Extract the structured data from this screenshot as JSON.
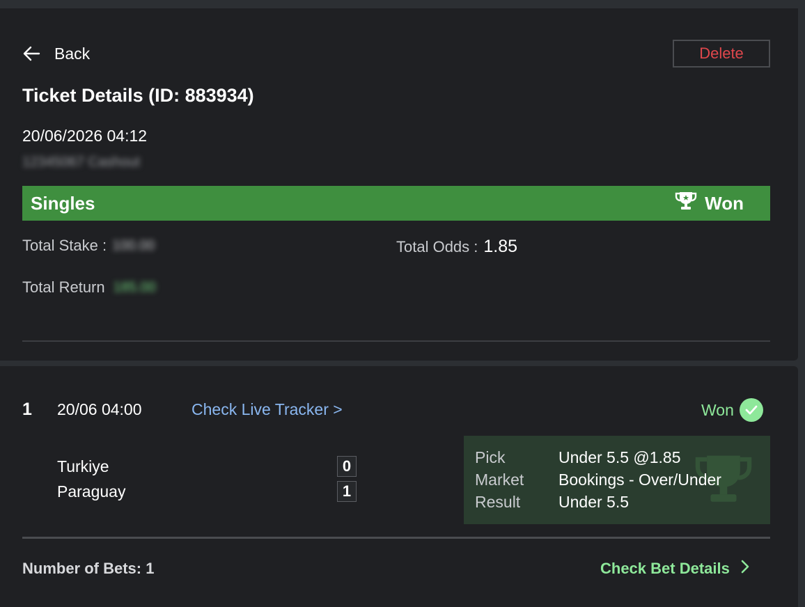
{
  "header": {
    "back_label": "Back",
    "delete_label": "Delete"
  },
  "ticket": {
    "title": "Ticket Details (ID: 883934)",
    "datetime": "20/06/2026 04:12",
    "sub_text_blurred": "12345067 Cashout",
    "bet_type": "Singles",
    "status": "Won",
    "total_stake_label": "Total Stake :",
    "total_stake_value_blurred": "100.00",
    "total_odds_label": "Total Odds :",
    "total_odds_value": "1.85",
    "total_return_label": "Total Return",
    "total_return_value_blurred": "185.00"
  },
  "bet": {
    "index": "1",
    "time": "20/06 04:00",
    "live_tracker_label": "Check Live Tracker >",
    "status": "Won",
    "home_team": "Turkiye",
    "away_team": "Paraguay",
    "home_score": "0",
    "away_score": "1",
    "pick_label": "Pick",
    "pick_value": "Under 5.5 @1.85",
    "market_label": "Market",
    "market_value": "Bookings - Over/Under",
    "result_label": "Result",
    "result_value": "Under 5.5"
  },
  "footer": {
    "number_of_bets": "Number of Bets: 1",
    "check_details_label": "Check Bet Details"
  },
  "colors": {
    "status_bar": "#3f8f3f",
    "won_text": "#8ee89a",
    "delete_text": "#e0474c",
    "link_blue": "#8ab7f0",
    "card_bg": "#1f2023"
  },
  "icons": [
    "back-arrow-icon",
    "trophy-icon",
    "check-circle-icon",
    "chevron-right-icon"
  ]
}
